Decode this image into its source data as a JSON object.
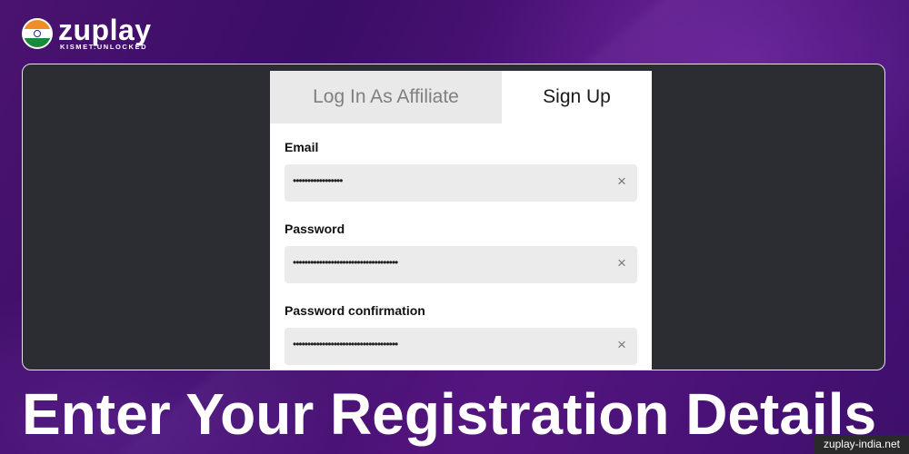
{
  "brand": {
    "name": "zuplay",
    "tagline": "KISMET.UNLOCKED",
    "flag_icon": "india-flag-icon"
  },
  "tabs": [
    {
      "label": "Log In As Affiliate",
      "active": false
    },
    {
      "label": "Sign Up",
      "active": true
    }
  ],
  "form": {
    "email": {
      "label": "Email",
      "value": "•••••••••••••••••"
    },
    "password": {
      "label": "Password",
      "value": "••••••••••••••••••••••••••••••••••••"
    },
    "password_confirmation": {
      "label": "Password confirmation",
      "value": "••••••••••••••••••••••••••••••••••••"
    },
    "clear_glyph": "×"
  },
  "headline": "Enter Your Registration Details",
  "site": "zuplay-india.net",
  "colors": {
    "background": "#3f0f6a",
    "frame": "#2c2c33",
    "tab_inactive": "#e9e9e9",
    "field_bg": "#ebebeb"
  }
}
